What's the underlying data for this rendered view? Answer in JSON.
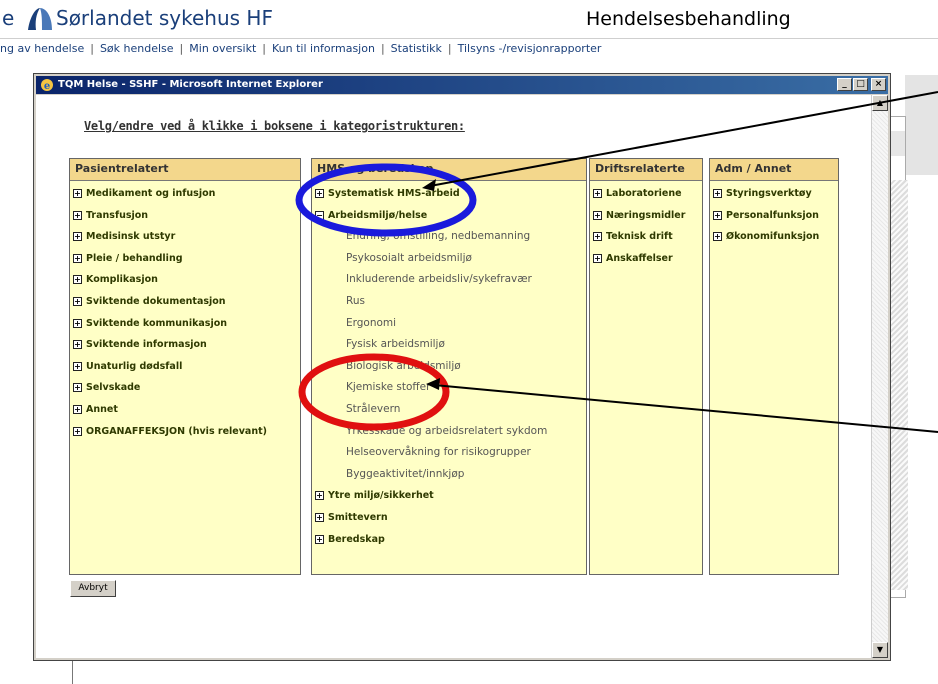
{
  "header": {
    "left_fragment": "e",
    "brand": "Sørlandet sykehus HF",
    "app_title": "Hendelsesbehandling",
    "brand_color": "#1a3f7a"
  },
  "nav": [
    "ng av hendelse",
    "Søk hendelse",
    "Min oversikt",
    "Kun til informasjon",
    "Statistikk",
    "Tilsyns -/revisjonrapporter"
  ],
  "window": {
    "title": "TQM Helse - SSHF - Microsoft Internet Explorer",
    "controls": [
      "minimize-icon",
      "maximize-icon",
      "close-icon"
    ],
    "instruction": "Velg/endre ved å klikke i boksene i kategoristrukturen:",
    "cancel_label": "Avbryt"
  },
  "columns": [
    {
      "header": "Pasientrelatert",
      "items": [
        {
          "label": "Medikament og infusjon"
        },
        {
          "label": "Transfusjon"
        },
        {
          "label": "Medisinsk utstyr"
        },
        {
          "label": "Pleie / behandling"
        },
        {
          "label": "Komplikasjon"
        },
        {
          "label": "Sviktende dokumentasjon"
        },
        {
          "label": "Sviktende kommunikasjon"
        },
        {
          "label": "Sviktende informasjon"
        },
        {
          "label": "Unaturlig dødsfall"
        },
        {
          "label": "Selvskade"
        },
        {
          "label": "Annet"
        },
        {
          "label": "ORGANAFFEKSJON (hvis relevant)"
        }
      ]
    },
    {
      "header": "HMS og beredskap",
      "items": [
        {
          "label": "Systematisk HMS-arbeid"
        },
        {
          "label": "Arbeidsmiljø/helse",
          "children": [
            "Endring, omstilling, nedbemanning",
            "Psykosoialt arbeidsmiljø",
            "Inkluderende arbeidsliv/sykefravær",
            "Rus",
            "Ergonomi",
            "Fysisk arbeidsmiljø",
            "Biologisk arbeidsmiljø",
            "Kjemiske stoffer",
            "Strålevern",
            "Yrkesskade og arbeidsrelatert sykdom",
            "Helseovervåkning for risikogrupper",
            "Byggeaktivitet/innkjøp"
          ]
        },
        {
          "label": "Ytre miljø/sikkerhet"
        },
        {
          "label": "Smittevern"
        },
        {
          "label": "Beredskap"
        }
      ]
    },
    {
      "header": "Driftsrelaterte",
      "items": [
        {
          "label": "Laboratoriene"
        },
        {
          "label": "Næringsmidler"
        },
        {
          "label": "Teknisk drift"
        },
        {
          "label": "Anskaffelser"
        }
      ]
    },
    {
      "header": "Adm / Annet",
      "items": [
        {
          "label": "Styringsverktøy"
        },
        {
          "label": "Personalfunksjon"
        },
        {
          "label": "Økonomifunksjon"
        }
      ]
    }
  ],
  "annotations": {
    "blue_circle_color": "#1a1adc",
    "red_circle_color": "#e01010",
    "arrow_color": "#000000"
  }
}
